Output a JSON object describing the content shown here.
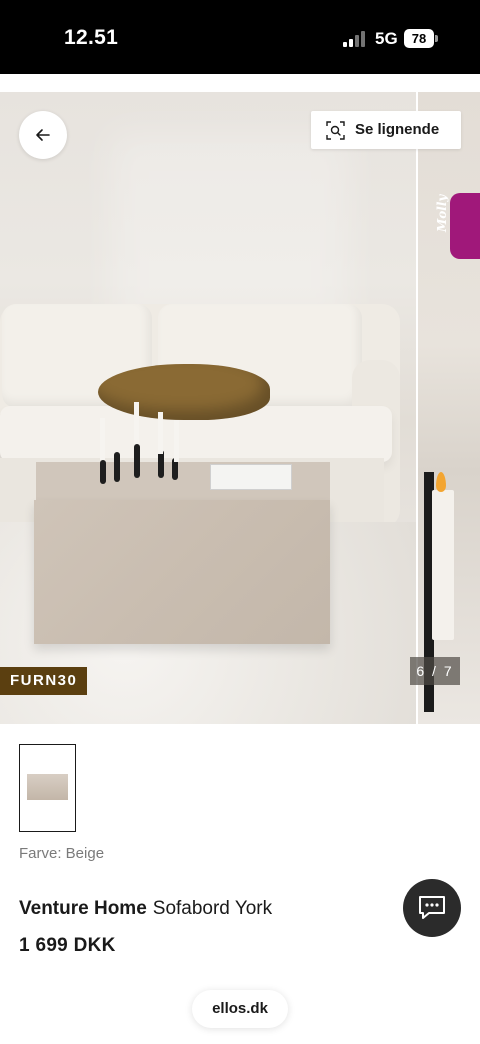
{
  "status_bar": {
    "time": "12.51",
    "network": "5G",
    "battery": "78"
  },
  "gallery": {
    "promo_code": "FURN30",
    "counter": "6 / 7",
    "similar_button_label": "Se lignende",
    "assistant_tab_label": "Molly",
    "back_icon": "arrow-left-icon",
    "similar_icon": "visual-search-icon"
  },
  "product": {
    "color_label": "Farve: Beige",
    "brand": "Venture Home",
    "name": "Sofabord York",
    "price": "1 699 DKK"
  },
  "chat": {
    "icon": "chat-icon"
  },
  "browser": {
    "url": "ellos.dk"
  },
  "colors": {
    "promo_badge": "#5b3f10",
    "assistant_tab": "#a0187a",
    "chat_button": "#2b2b2b"
  }
}
